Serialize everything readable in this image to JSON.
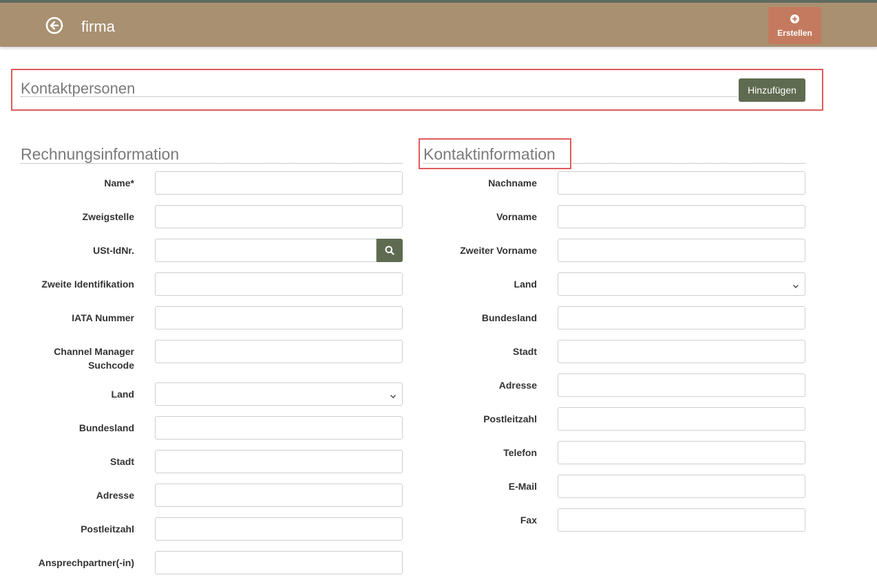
{
  "header": {
    "title": "firma",
    "create_label": "Erstellen"
  },
  "contacts": {
    "title": "Kontaktpersonen",
    "add_label": "Hinzufügen"
  },
  "billing": {
    "title": "Rechnungsinformation",
    "fields": {
      "name": {
        "label": "Name*",
        "value": ""
      },
      "branch": {
        "label": "Zweigstelle",
        "value": ""
      },
      "vat": {
        "label": "USt-IdNr.",
        "value": ""
      },
      "second_id": {
        "label": "Zweite Identifikation",
        "value": ""
      },
      "iata": {
        "label": "IATA Nummer",
        "value": ""
      },
      "channel_line1": "Channel Manager",
      "channel_line2": "Suchcode",
      "country": {
        "label": "Land",
        "value": ""
      },
      "state": {
        "label": "Bundesland",
        "value": ""
      },
      "city": {
        "label": "Stadt",
        "value": ""
      },
      "address": {
        "label": "Adresse",
        "value": ""
      },
      "zip": {
        "label": "Postleitzahl",
        "value": ""
      },
      "contact_person": {
        "label": "Ansprechpartner(-in)",
        "value": ""
      }
    }
  },
  "contact_info": {
    "title": "Kontaktinformation",
    "fields": {
      "last_name": {
        "label": "Nachname",
        "value": ""
      },
      "first_name": {
        "label": "Vorname",
        "value": ""
      },
      "middle_name": {
        "label": "Zweiter Vorname",
        "value": ""
      },
      "country": {
        "label": "Land",
        "value": ""
      },
      "state": {
        "label": "Bundesland",
        "value": ""
      },
      "city": {
        "label": "Stadt",
        "value": ""
      },
      "address": {
        "label": "Adresse",
        "value": ""
      },
      "zip": {
        "label": "Postleitzahl",
        "value": ""
      },
      "phone": {
        "label": "Telefon",
        "value": ""
      },
      "email": {
        "label": "E-Mail",
        "value": ""
      },
      "fax": {
        "label": "Fax",
        "value": ""
      }
    }
  },
  "colors": {
    "header_bg": "#a89070",
    "create_button": "#c47a5e",
    "primary_button": "#5f6b50",
    "highlight_border": "#e05a5a"
  },
  "icons": {
    "back": "arrow-left-circle-icon",
    "create": "plus-circle-icon",
    "search": "search-icon",
    "dropdown": "chevron-down-icon"
  }
}
